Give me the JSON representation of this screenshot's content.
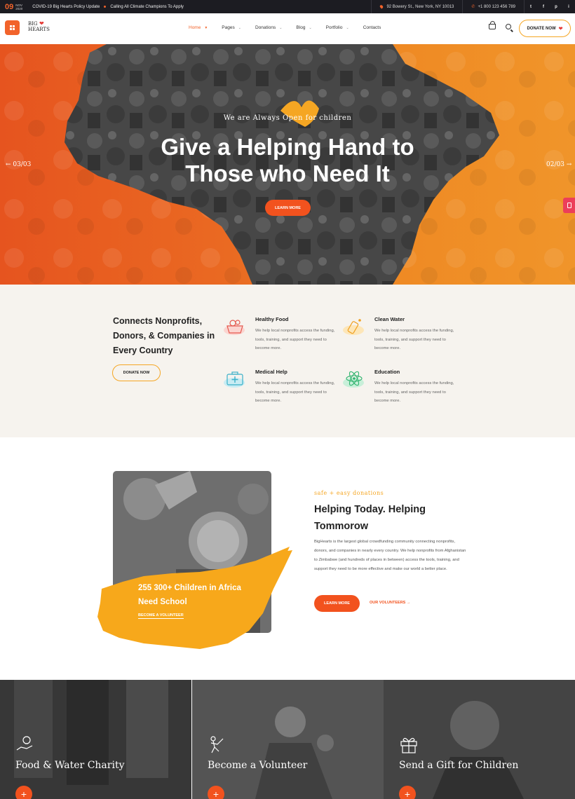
{
  "topbar": {
    "day": "09",
    "month": "NOV",
    "year": "2020",
    "news": [
      "COVID-19 Big Hearts Policy Update",
      "Calling All Climate Champions To Apply"
    ],
    "address": "92 Bowery St., New York, NY 10013",
    "phone": "+1 800 123 456 789",
    "social": [
      "t",
      "f",
      "p",
      "i"
    ]
  },
  "header": {
    "logo_line1": "BIG",
    "logo_line2": "HEARTS",
    "nav": [
      {
        "label": "Home",
        "active": true,
        "dropdown": true
      },
      {
        "label": "Pages",
        "dropdown": true
      },
      {
        "label": "Donations",
        "dropdown": true
      },
      {
        "label": "Blog",
        "dropdown": true
      },
      {
        "label": "Portfolio",
        "dropdown": true
      },
      {
        "label": "Contacts",
        "dropdown": false
      }
    ],
    "donate_label": "DONATE NOW"
  },
  "hero": {
    "tagline": "We are Always Open for children",
    "title_line1": "Give a Helping Hand to",
    "title_line2": "Those who Need It",
    "button_label": "LEARN MORE",
    "prev_label": "03/03",
    "next_label": "02/03"
  },
  "features": {
    "heading": "Connects Nonprofits, Donors, & Companies in Every Country",
    "button_label": "DONATE NOW",
    "items": [
      {
        "title": "Healthy Food",
        "text": "We help local nonprofits access the funding, tools, training, and support they need to become more.",
        "icon": "food-icon"
      },
      {
        "title": "Clean Water",
        "text": "We help local nonprofits access the funding, tools, training, and support they need to become more.",
        "icon": "water-bottle-icon"
      },
      {
        "title": "Medical Help",
        "text": "We help local nonprofits access the funding, tools, training, and support they need to become more.",
        "icon": "first-aid-icon"
      },
      {
        "title": "Education",
        "text": "We help local nonprofits access the funding, tools, training, and support they need to become more.",
        "icon": "atom-icon"
      }
    ]
  },
  "about": {
    "splash_text": "255 300+ Children in Africa Need School",
    "splash_link": "BECOME A VOLUNTEER",
    "tagline": "safe + easy donations",
    "title": "Helping Today. Helping Tommorow",
    "text": "BigHearts is the largest global crowdfunding community connecting nonprofits, donors, and companies in nearly every country. We help nonprofits from Afghanistan to Zimbabwe (and hundreds of places in between) access the tools, training, and support they need to be more effective and make our world a better place.",
    "button_label": "LEARN MORE",
    "link_label": "OUR VOLUNTEERS"
  },
  "cards": [
    {
      "title": "Food & Water Charity",
      "icon": "hand-bulb-icon"
    },
    {
      "title": "Become a Volunteer",
      "icon": "volunteer-icon"
    },
    {
      "title": "Send a Gift for Children",
      "icon": "gift-icon"
    }
  ],
  "colors": {
    "accent": "#f2521e",
    "yellow": "#f5a623",
    "dark": "#1c1c22",
    "beige": "#f6f3ee"
  }
}
